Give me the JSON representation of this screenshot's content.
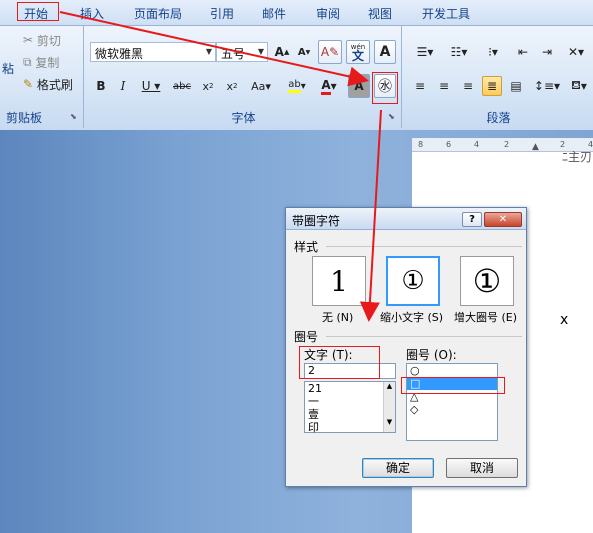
{
  "tabs": [
    "开始",
    "插入",
    "页面布局",
    "引用",
    "邮件",
    "审阅",
    "视图",
    "开发工具"
  ],
  "clipboard": {
    "cut": "剪切",
    "copy": "复制",
    "format_painter": "格式刷",
    "paste": "粘",
    "label": "剪贴板"
  },
  "font": {
    "name": "微软雅黑",
    "size": "五号",
    "label": "字体",
    "wen_icon": "wén",
    "wen_char": "文"
  },
  "paragraph": {
    "label": "段落"
  },
  "ruler": [
    "8",
    "6",
    "4",
    "2",
    "2",
    "4"
  ],
  "page_text": "x",
  "page_top_text": "ﾆ主刃",
  "dialog": {
    "title": "带圈字符",
    "help": "?",
    "close": "✕",
    "style_label": "样式",
    "styles": [
      {
        "glyph": "1",
        "label": "无 (N)"
      },
      {
        "glyph": "①",
        "label": "缩小文字 (S)"
      },
      {
        "glyph": "①",
        "label": "增大圈号 (E)"
      }
    ],
    "enclosure_label": "圈号",
    "text_label": "文字 (T):",
    "text_value": "2",
    "text_list": [
      "21",
      "一",
      "壹",
      "印"
    ],
    "circle_label": "圈号 (O):",
    "circle_list": [
      "○",
      "□",
      "△",
      "◇"
    ],
    "ok": "确定",
    "cancel": "取消"
  },
  "colors": {
    "accent": "#e8191b",
    "selection": "#3399ff"
  }
}
